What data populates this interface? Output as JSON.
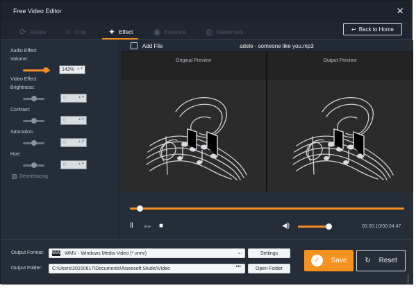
{
  "window": {
    "title": "Free Video Editor",
    "close_icon": "close-icon"
  },
  "tabs": [
    {
      "label": "Rotate",
      "icon": "rotate-icon",
      "active": false
    },
    {
      "label": "Crop",
      "icon": "crop-icon",
      "active": false
    },
    {
      "label": "Effect",
      "icon": "effect-icon",
      "active": true
    },
    {
      "label": "Enhance",
      "icon": "enhance-icon",
      "active": false
    },
    {
      "label": "Watermark",
      "icon": "watermark-icon",
      "active": false
    }
  ],
  "back_home": {
    "label": "Back to Home",
    "icon": "back-arrow-icon"
  },
  "effects": {
    "audio_section": "Audio Effect",
    "volume_label": "Volume:",
    "volume_value": "143%",
    "video_section": "Video Effect",
    "brightness_label": "Brightness:",
    "brightness_value": "0",
    "contrast_label": "Contrast:",
    "contrast_value": "0",
    "saturation_label": "Saturation:",
    "saturation_value": "0",
    "hue_label": "Hue:",
    "hue_value": "0",
    "deinterlacing_label": "Deinterlacing"
  },
  "file_bar": {
    "add_file": "Add File",
    "filename": "adele - someone like you.mp3"
  },
  "previews": {
    "original": "Original Preview",
    "output": "Output Preview"
  },
  "player": {
    "time": "00:00:10/00:04:47"
  },
  "output": {
    "format_label": "Output Format:",
    "format_value": "WMV - Windows Media Video (*.wmv)",
    "format_icon": "wmv-format-icon",
    "settings": "Settings",
    "folder_label": "Output Folder:",
    "folder_value": "C:\\Users\\20150617\\Documents\\Aiseesoft Studio\\Video",
    "folder_dots": "•••",
    "open_folder": "Open Folder"
  },
  "actions": {
    "save": "Save",
    "reset": "Reset"
  },
  "colors": {
    "accent": "#f48b22",
    "background": "#252d38",
    "preview": "#2b2b2b"
  }
}
